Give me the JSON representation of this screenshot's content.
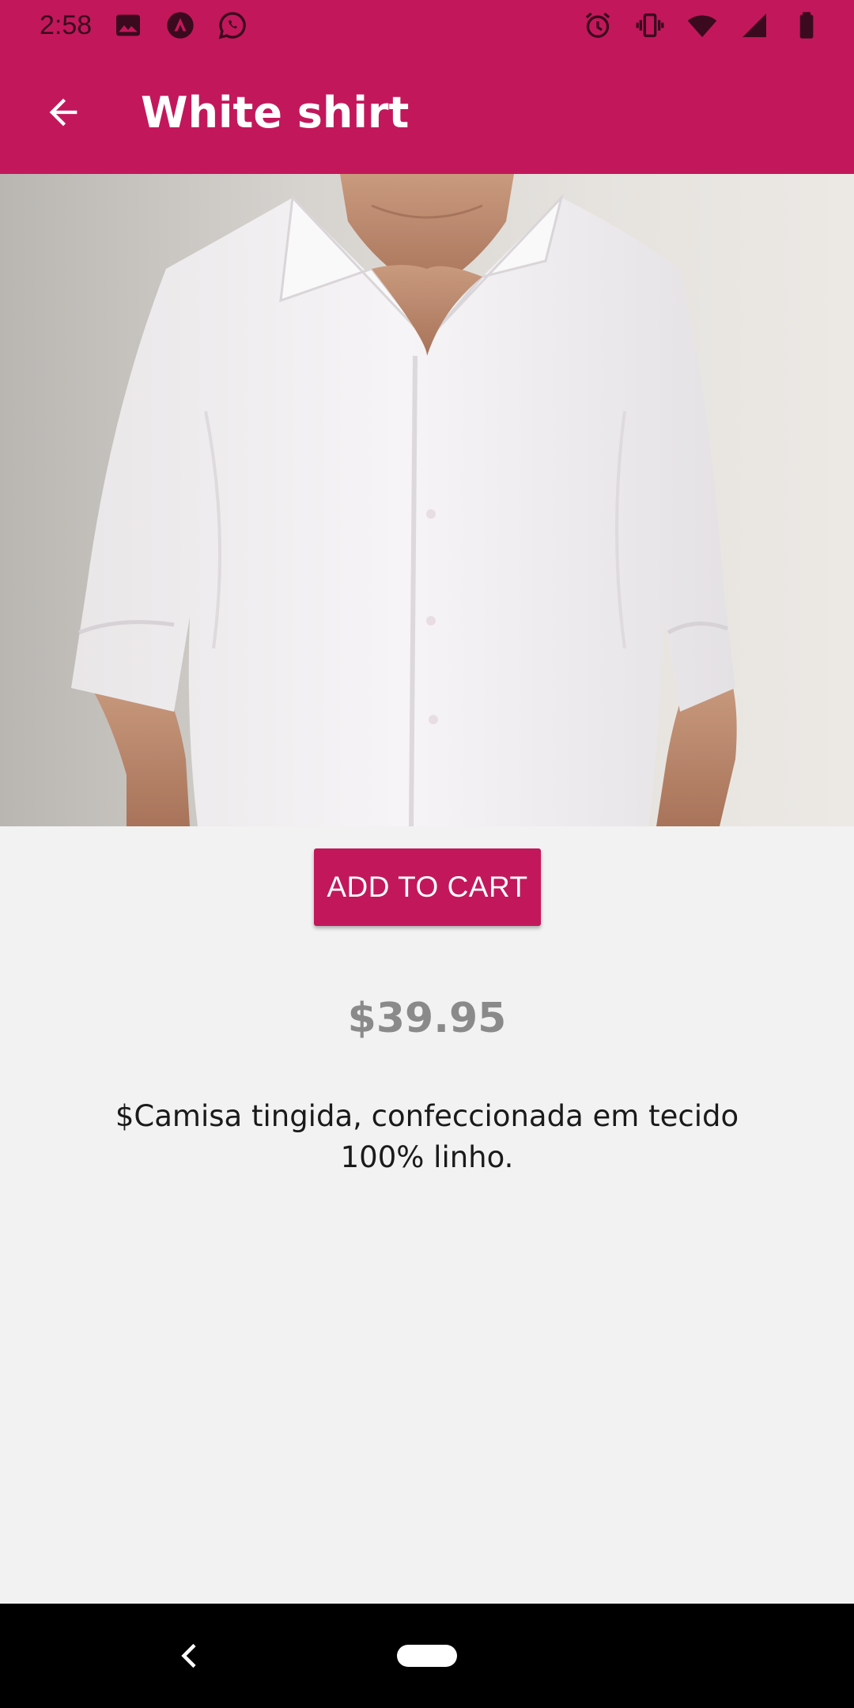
{
  "status_bar": {
    "time": "2:58",
    "left_icons": [
      "image-icon",
      "app-notification-icon",
      "whatsapp-icon"
    ],
    "right_icons": [
      "alarm-icon",
      "vibrate-icon",
      "wifi-icon",
      "signal-icon",
      "battery-icon"
    ]
  },
  "app_bar": {
    "back_icon": "arrow-back-icon",
    "title": "White shirt"
  },
  "product": {
    "image_alt": "white-shirt-photo",
    "add_to_cart_label": "ADD TO CART",
    "price": "$39.95",
    "description": "$Camisa tingida, confeccionada em tecido 100% linho."
  },
  "nav_bar": {
    "back_icon": "nav-back-icon",
    "home_icon": "home-pill-icon"
  },
  "colors": {
    "primary": "#c2185b",
    "background": "#f2f2f2",
    "price_text": "#8a8a8a",
    "nav_bar": "#000000"
  }
}
